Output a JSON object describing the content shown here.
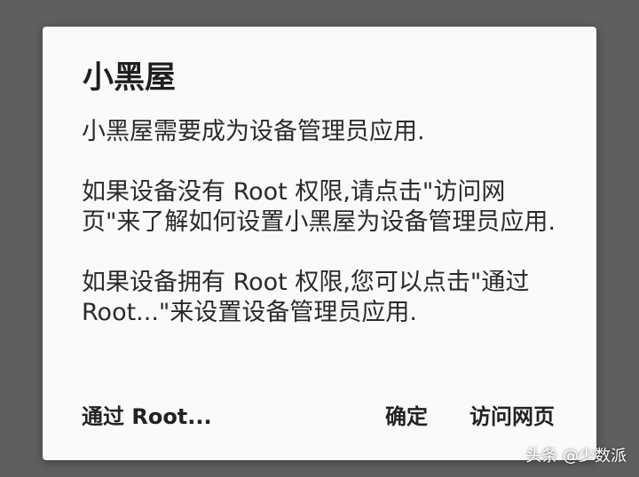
{
  "dialog": {
    "title": "小黑屋",
    "paragraphs": [
      "小黑屋需要成为设备管理员应用.",
      "如果设备没有 Root 权限,请点击\"访问网页\"来了解如何设置小黑屋为设备管理员应用.",
      "如果设备拥有 Root 权限,您可以点击\"通过 Root...\"来设置设备管理员应用."
    ],
    "buttons": {
      "via_root": "通过 Root...",
      "confirm": "确定",
      "visit_web": "访问网页"
    }
  },
  "watermark": "头条 @少数派",
  "colors": {
    "overlay": "#5f5f5f",
    "dialog_bg": "#fafafa",
    "text": "#2a2a2a"
  }
}
